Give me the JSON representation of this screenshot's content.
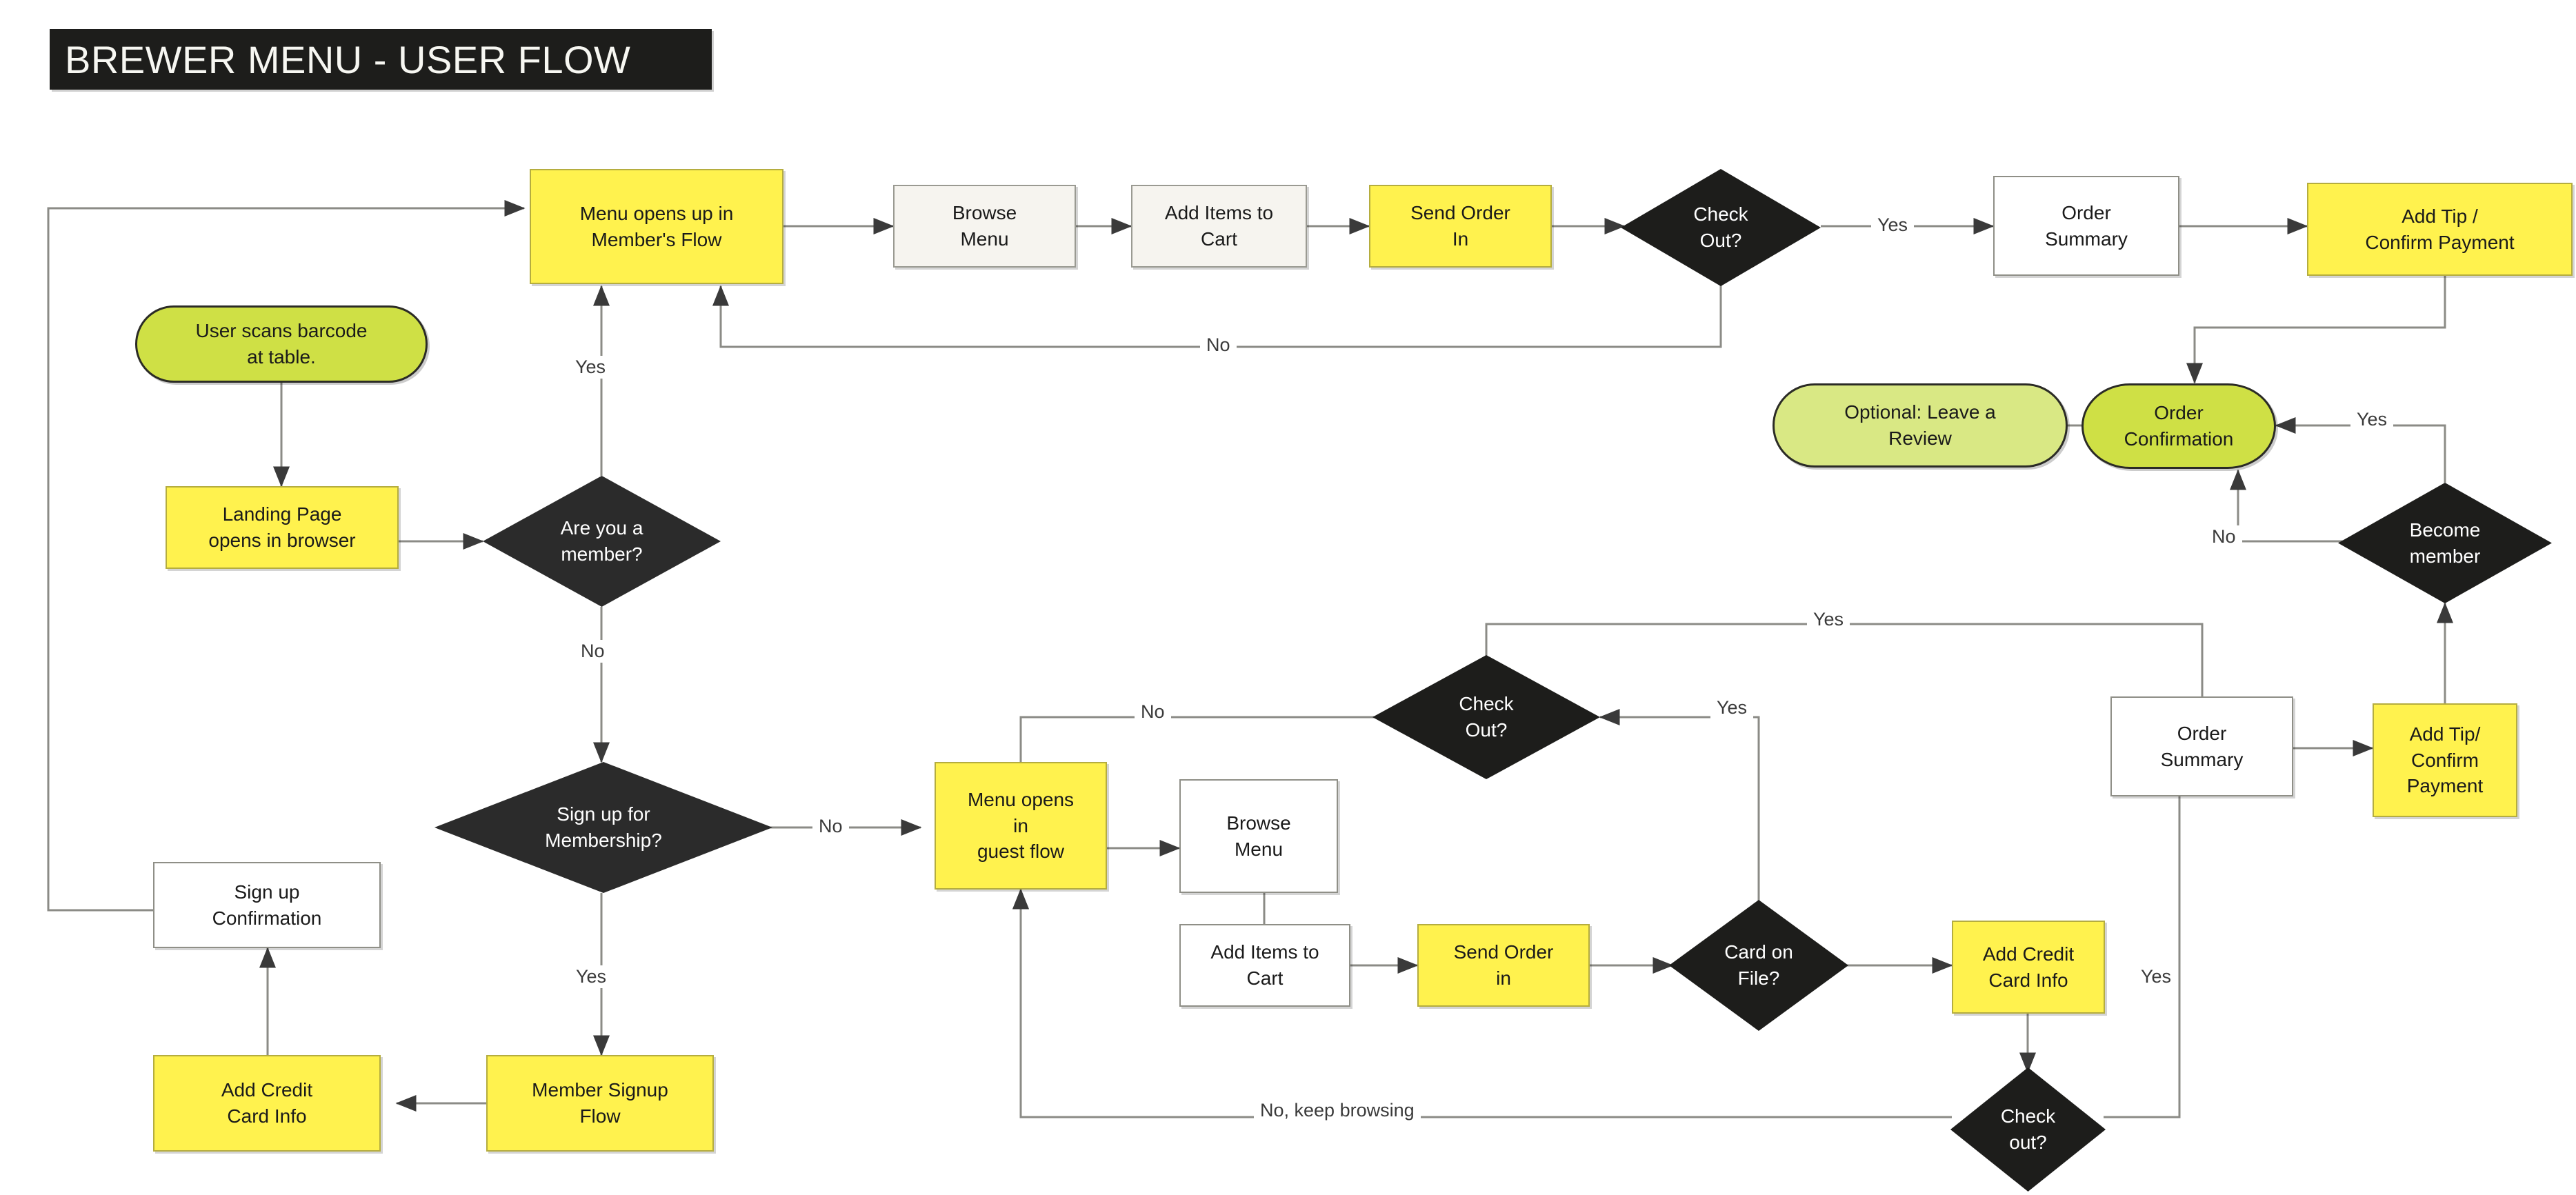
{
  "title": {
    "text": "BREWER MENU - USER FLOW"
  },
  "palette": {
    "yellow": "#fff24e",
    "green_dark": "#cfe045",
    "green_light": "#d9e884",
    "decision_black": "#1d1d1b",
    "plain": "#f6f4ef",
    "white": "#ffffff",
    "edge": "#7d7d78",
    "title_bg": "#1d1d1b",
    "title_fg": "#f7f7f2"
  },
  "nodes": [
    {
      "id": "menu_member",
      "label": "Menu opens up in\nMember's Flow",
      "shape": "rect",
      "style": "yellow"
    },
    {
      "id": "browse_member",
      "label": "Browse\nMenu",
      "shape": "rect",
      "style": "plain"
    },
    {
      "id": "cart_member",
      "label": "Add Items to\nCart",
      "shape": "rect",
      "style": "plain"
    },
    {
      "id": "send_member",
      "label": "Send Order\nIn",
      "shape": "rect",
      "style": "yellow"
    },
    {
      "id": "checkout_member",
      "label": "Check\nOut?",
      "shape": "diamond",
      "style": "decision"
    },
    {
      "id": "summary_member",
      "label": "Order\nSummary",
      "shape": "rect",
      "style": "white"
    },
    {
      "id": "tip_member",
      "label": "Add Tip /\nConfirm Payment",
      "shape": "rect",
      "style": "yellow"
    },
    {
      "id": "review",
      "label": "Optional: Leave a\nReview",
      "shape": "terminal",
      "style": "green_light"
    },
    {
      "id": "order_conf",
      "label": "Order\nConfirmation",
      "shape": "terminal",
      "style": "green_dark"
    },
    {
      "id": "become_member",
      "label": "Become\nmember",
      "shape": "diamond",
      "style": "decision"
    },
    {
      "id": "scan",
      "label": "User scans barcode\nat table.",
      "shape": "terminal",
      "style": "green_dark"
    },
    {
      "id": "landing",
      "label": "Landing Page\nopens in browser",
      "shape": "rect",
      "style": "yellow"
    },
    {
      "id": "are_member",
      "label": "Are you a\nmember?",
      "shape": "diamond",
      "style": "decision"
    },
    {
      "id": "signup_q",
      "label": "Sign up for\nMembership?",
      "shape": "diamond",
      "style": "decision"
    },
    {
      "id": "signup_conf",
      "label": "Sign up\nConfirmation",
      "shape": "rect",
      "style": "white"
    },
    {
      "id": "cc_member",
      "label": "Add Credit\nCard Info",
      "shape": "rect",
      "style": "yellow"
    },
    {
      "id": "member_signup",
      "label": "Member Signup\nFlow",
      "shape": "rect",
      "style": "yellow"
    },
    {
      "id": "menu_guest",
      "label": "Menu opens\nin\nguest flow",
      "shape": "rect",
      "style": "yellow"
    },
    {
      "id": "browse_guest",
      "label": "Browse\nMenu",
      "shape": "rect",
      "style": "white"
    },
    {
      "id": "checkout_guest",
      "label": "Check\nOut?",
      "shape": "diamond",
      "style": "decision"
    },
    {
      "id": "cart_guest",
      "label": "Add Items to\nCart",
      "shape": "rect",
      "style": "white"
    },
    {
      "id": "send_guest",
      "label": "Send Order\nin",
      "shape": "rect",
      "style": "yellow"
    },
    {
      "id": "card_on_file",
      "label": "Card on\nFile?",
      "shape": "diamond",
      "style": "decision"
    },
    {
      "id": "cc_guest",
      "label": "Add Credit\nCard Info",
      "shape": "rect",
      "style": "yellow"
    },
    {
      "id": "checkout_guest2",
      "label": "Check\nout?",
      "shape": "diamond",
      "style": "decision"
    },
    {
      "id": "summary_guest",
      "label": "Order\nSummary",
      "shape": "rect",
      "style": "white"
    },
    {
      "id": "tip_guest",
      "label": "Add Tip/\nConfirm\nPayment",
      "shape": "rect",
      "style": "yellow"
    }
  ],
  "edge_labels": [
    {
      "id": "l_checkout_member_yes",
      "text": "Yes"
    },
    {
      "id": "l_checkout_member_no",
      "text": "No"
    },
    {
      "id": "l_are_member_yes",
      "text": "Yes"
    },
    {
      "id": "l_are_member_no",
      "text": "No"
    },
    {
      "id": "l_signup_no",
      "text": "No"
    },
    {
      "id": "l_signup_yes",
      "text": "Yes"
    },
    {
      "id": "l_checkout_guest_no",
      "text": "No"
    },
    {
      "id": "l_checkout_guest_yes_top",
      "text": "Yes"
    },
    {
      "id": "l_checkout_guest_yes_in",
      "text": "Yes"
    },
    {
      "id": "l_checkout_guest2_yes",
      "text": "Yes"
    },
    {
      "id": "l_keep_browsing",
      "text": "No, keep browsing"
    },
    {
      "id": "l_become_member_yes",
      "text": "Yes"
    },
    {
      "id": "l_become_member_no",
      "text": "No"
    }
  ]
}
